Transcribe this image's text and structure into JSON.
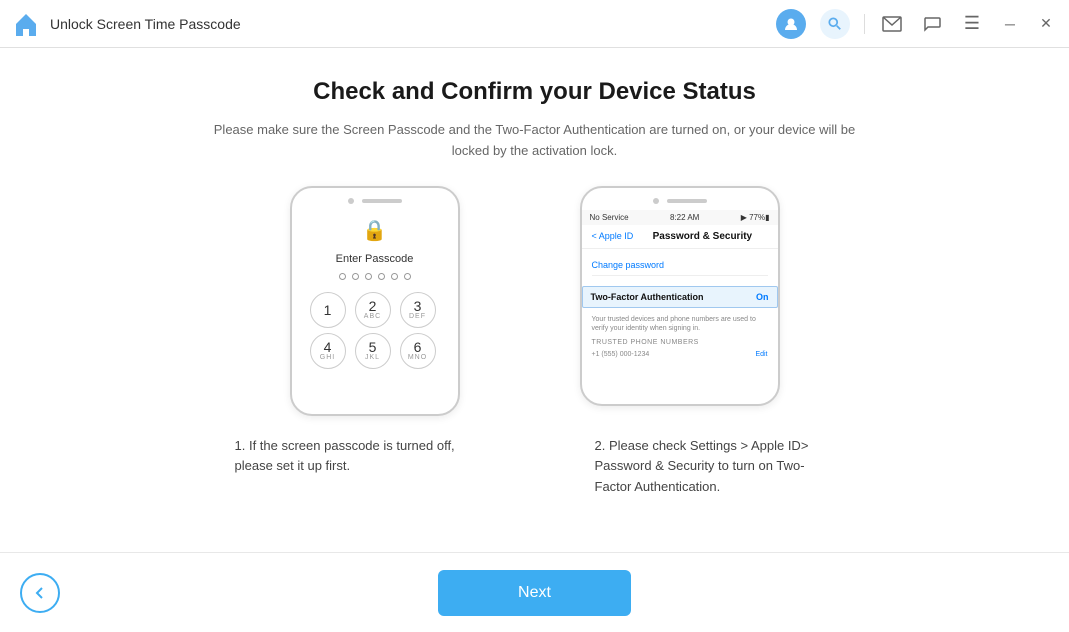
{
  "titleBar": {
    "title": "Unlock Screen Time Passcode",
    "icons": {
      "user": "👤",
      "search": "🔍",
      "mail": "✉",
      "chat": "💬",
      "menu": "≡",
      "minimize": "─",
      "close": "✕"
    }
  },
  "main": {
    "title": "Check and Confirm your Device Status",
    "subtitle": "Please make sure the Screen Passcode and the Two-Factor Authentication are turned on, or your device will be locked by the activation lock.",
    "phone1": {
      "enterPasscodeText": "Enter Passcode",
      "numpad": [
        {
          "num": "1",
          "sub": ""
        },
        {
          "num": "2",
          "sub": "ABC"
        },
        {
          "num": "3",
          "sub": "DEF"
        },
        {
          "num": "4",
          "sub": "GHI"
        },
        {
          "num": "5",
          "sub": "JKL"
        },
        {
          "num": "6",
          "sub": "MNO"
        }
      ]
    },
    "phone2": {
      "status": {
        "carrier": "No Service",
        "time": "8:22 AM",
        "battery": "77%"
      },
      "backLabel": "< Apple ID",
      "settingsTitle": "Password & Security",
      "changePassword": "Change password",
      "twoFactorLabel": "Two-Factor Authentication",
      "twoFactorStatus": "On",
      "trustedLabel": "TRUSTED PHONE NUMBERS",
      "editLabel": "Edit"
    },
    "desc1": "1. If the screen passcode is turned off, please set it up first.",
    "desc2": "2. Please check Settings > Apple ID> Password & Security to turn on Two-Factor Authentication.",
    "nextButton": "Next"
  }
}
